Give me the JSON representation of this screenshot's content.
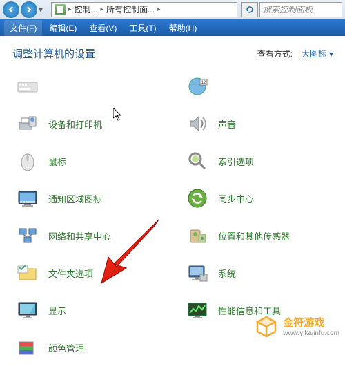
{
  "titlebar": {
    "addr_seg1": "控制...",
    "addr_seg2": "所有控制面...",
    "search_placeholder": "搜索控制面板"
  },
  "menubar": {
    "file": "文件(F)",
    "edit": "编辑(E)",
    "view": "查看(V)",
    "tools": "工具(T)",
    "help": "帮助(H)"
  },
  "header": {
    "title": "调整计算机的设置",
    "view_label": "查看方式:",
    "view_value": "大图标"
  },
  "items": [
    {
      "label": "",
      "icon": "keyboard"
    },
    {
      "label": "",
      "icon": "region"
    },
    {
      "label": "设备和打印机",
      "icon": "devices-printers"
    },
    {
      "label": "声音",
      "icon": "sound"
    },
    {
      "label": "鼠标",
      "icon": "mouse"
    },
    {
      "label": "索引选项",
      "icon": "index"
    },
    {
      "label": "通知区域图标",
      "icon": "notification-area"
    },
    {
      "label": "同步中心",
      "icon": "sync-center"
    },
    {
      "label": "网络和共享中心",
      "icon": "network-sharing"
    },
    {
      "label": "位置和其他传感器",
      "icon": "location-sensors"
    },
    {
      "label": "文件夹选项",
      "icon": "folder-options"
    },
    {
      "label": "系统",
      "icon": "system"
    },
    {
      "label": "显示",
      "icon": "display"
    },
    {
      "label": "性能信息和工具",
      "icon": "performance"
    },
    {
      "label": "颜色管理",
      "icon": "color-management"
    }
  ],
  "watermark": {
    "title": "金符游戏",
    "url": "www.yikajinfu.com"
  }
}
